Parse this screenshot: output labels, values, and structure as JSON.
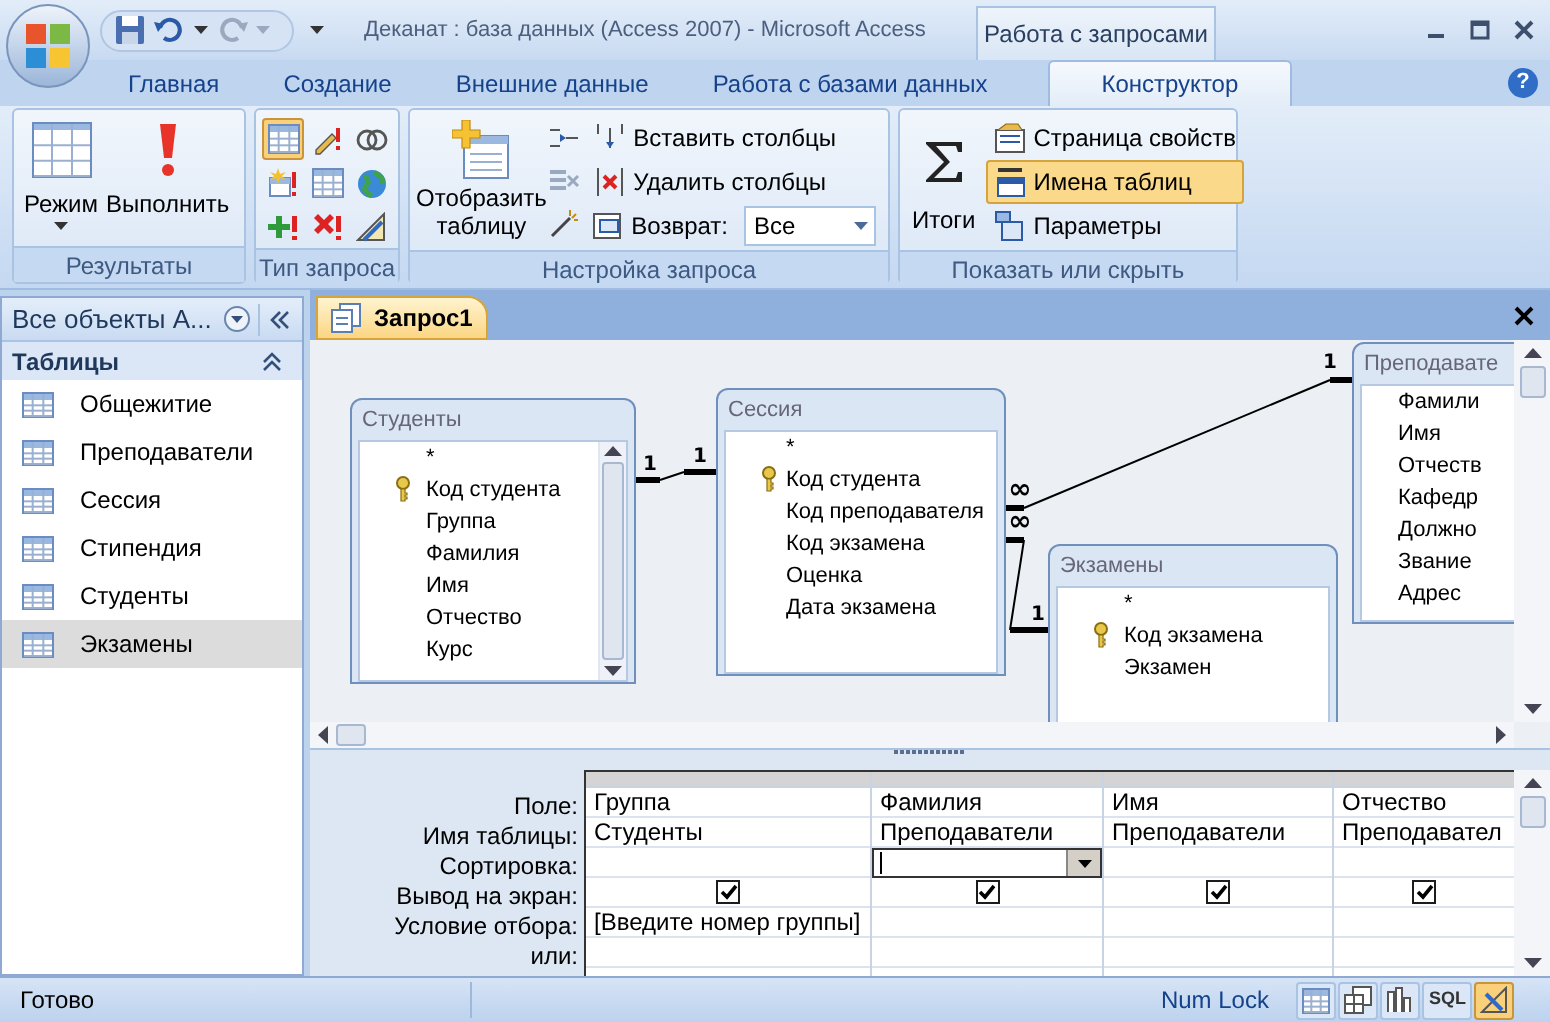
{
  "window": {
    "title": "Деканат : база данных (Access 2007)  -  Microsoft Access",
    "context_group": "Работа с запросами",
    "help": "?"
  },
  "ribbon_tabs": [
    {
      "label": "Главная",
      "selected": false
    },
    {
      "label": "Создание",
      "selected": false
    },
    {
      "label": "Внешние данные",
      "selected": false
    },
    {
      "label": "Работа с базами данных",
      "selected": false
    },
    {
      "label": "Конструктор",
      "selected": true
    }
  ],
  "ribbon": {
    "results": {
      "title": "Результаты",
      "buttons": [
        {
          "label": "Режим",
          "dropdown": true
        },
        {
          "label": "Выполнить",
          "dropdown": false
        }
      ]
    },
    "query_type": {
      "title": "Тип запроса",
      "buttons": [
        {
          "selected": true
        },
        {
          "selected": false
        },
        {
          "selected": false
        },
        {
          "selected": false
        },
        {
          "selected": false
        },
        {
          "selected": false
        },
        {
          "selected": false
        },
        {
          "selected": false
        },
        {
          "selected": false
        }
      ]
    },
    "query_setup": {
      "title": "Настройка запроса",
      "show_table": "Отобразить таблицу",
      "commands": [
        {
          "label": "Вставить столбцы"
        },
        {
          "label": "Удалить столбцы"
        }
      ],
      "return": {
        "label": "Возврат:",
        "value": "Все"
      }
    },
    "show_hide": {
      "title": "Показать или скрыть",
      "totals": "Итоги",
      "toggles": [
        {
          "label": "Страница свойств",
          "selected": false
        },
        {
          "label": "Имена таблиц",
          "selected": true
        },
        {
          "label": "Параметры",
          "selected": false
        }
      ]
    }
  },
  "navigation": {
    "title": "Все объекты А...",
    "section": {
      "title": "Таблицы",
      "expanded": true,
      "items": [
        {
          "label": "Общежитие",
          "selected": false
        },
        {
          "label": "Преподаватели",
          "selected": false
        },
        {
          "label": "Сессия",
          "selected": false
        },
        {
          "label": "Стипендия",
          "selected": false
        },
        {
          "label": "Студенты",
          "selected": false
        },
        {
          "label": "Экзамены",
          "selected": true
        }
      ]
    }
  },
  "document_tab": {
    "label": "Запрос1",
    "selected": true
  },
  "diagram": {
    "tables": [
      {
        "title": "Студенты",
        "scrollbar": true,
        "fields": [
          {
            "name": "*",
            "primary_key": false
          },
          {
            "name": "Код студента",
            "primary_key": true
          },
          {
            "name": "Группа",
            "primary_key": false
          },
          {
            "name": "Фамилия",
            "primary_key": false
          },
          {
            "name": "Имя",
            "primary_key": false
          },
          {
            "name": "Отчество",
            "primary_key": false
          },
          {
            "name": "Курс",
            "primary_key": false
          }
        ]
      },
      {
        "title": "Сессия",
        "scrollbar": false,
        "fields": [
          {
            "name": "*",
            "primary_key": false
          },
          {
            "name": "Код студента",
            "primary_key": true
          },
          {
            "name": "Код преподавателя",
            "primary_key": false
          },
          {
            "name": "Код экзамена",
            "primary_key": false
          },
          {
            "name": "Оценка",
            "primary_key": false
          },
          {
            "name": "Дата экзамена",
            "primary_key": false
          }
        ]
      },
      {
        "title": "Экзамены",
        "scrollbar": false,
        "fields": [
          {
            "name": "*",
            "primary_key": false
          },
          {
            "name": "Код экзамена",
            "primary_key": true
          },
          {
            "name": "Экзамен",
            "primary_key": false
          }
        ]
      },
      {
        "title": "Преподавате",
        "fields": [
          {
            "name": "Фамили",
            "primary_key": false
          },
          {
            "name": "Имя",
            "primary_key": false
          },
          {
            "name": "Отчеств",
            "primary_key": false
          },
          {
            "name": "Кафедр",
            "primary_key": false
          },
          {
            "name": "Должно",
            "primary_key": false
          },
          {
            "name": "Звание",
            "primary_key": false
          },
          {
            "name": "Адрес",
            "primary_key": false
          }
        ]
      }
    ],
    "relations": [
      {
        "labels": [
          "1",
          "1"
        ]
      },
      {
        "labels": [
          "∞",
          "1"
        ]
      },
      {
        "labels": [
          "∞",
          "1"
        ]
      }
    ]
  },
  "grid": {
    "row_labels": [
      "Поле:",
      "Имя таблицы:",
      "Сортировка:",
      "Вывод на экран:",
      "Условие отбора:",
      "или:"
    ],
    "columns": [
      {
        "field": "Группа",
        "table": "Студенты",
        "show": true,
        "criteria": "[Введите номер группы]",
        "focused": false
      },
      {
        "field": "Фамилия",
        "table": "Преподаватели",
        "show": true,
        "focused": true
      },
      {
        "field": "Имя",
        "table": "Преподаватели",
        "show": true,
        "focused": false
      },
      {
        "field": "Отчество",
        "table": "Преподавател",
        "show": true,
        "focused": false
      }
    ]
  },
  "status_bar": {
    "status": "Готово",
    "indicator": "Num Lock",
    "views": [
      {
        "kind": "datasheet",
        "selected": false
      },
      {
        "kind": "pivot_table",
        "selected": false
      },
      {
        "kind": "pivot_chart",
        "selected": false
      },
      {
        "kind": "sql",
        "label": "SQL",
        "selected": false
      },
      {
        "kind": "design",
        "selected": true
      }
    ]
  }
}
